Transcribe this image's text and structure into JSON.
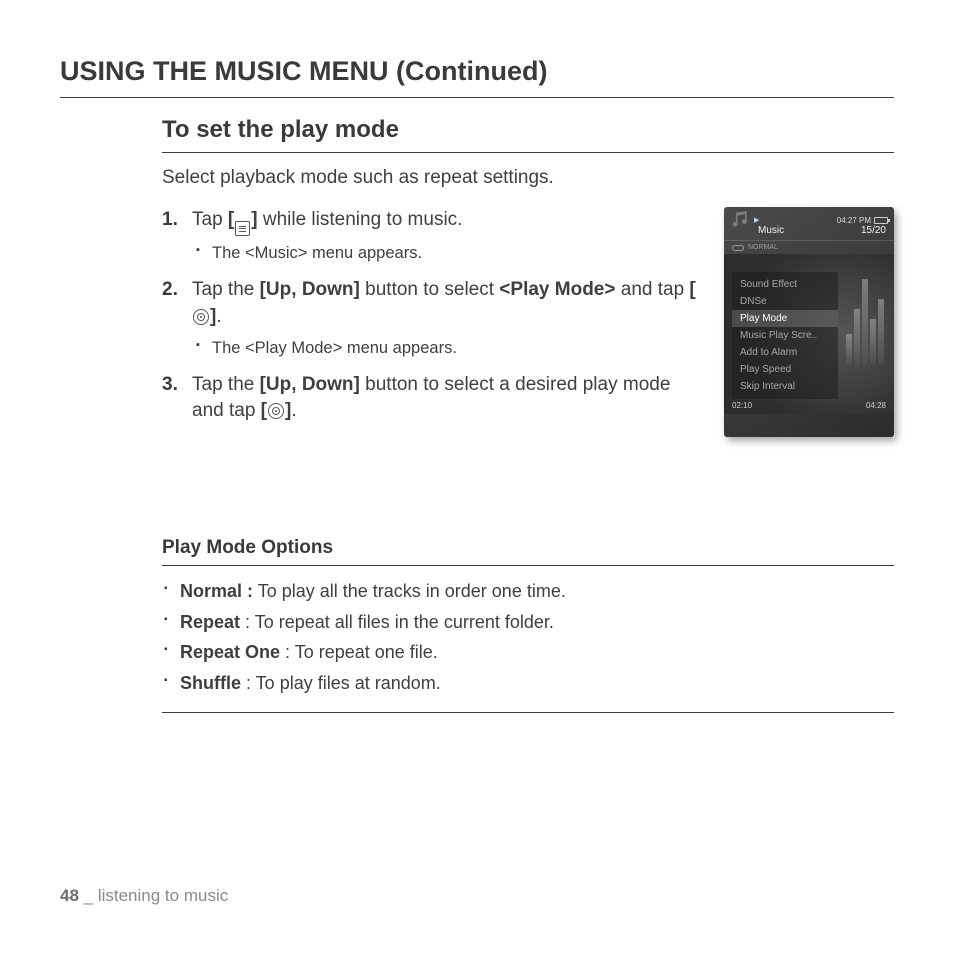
{
  "header": {
    "title": "USING THE MUSIC MENU (Continued)"
  },
  "section": {
    "title": "To set the play mode",
    "intro": "Select playback mode such as repeat settings."
  },
  "steps": [
    {
      "pre": "Tap ",
      "btn_open": "[",
      "btn_close": "]",
      "icon": "menu-icon",
      "post": " while listening to music.",
      "sub": "The <Music> menu appears."
    },
    {
      "pre": "Tap the ",
      "bold1": "[Up, Down]",
      "mid1": " button to select ",
      "bold2": "<Play Mode>",
      "mid2": " and tap ",
      "btn_open": "[",
      "btn_close": "]",
      "icon": "target-icon",
      "post": ".",
      "sub": "The <Play Mode> menu appears."
    },
    {
      "pre": "Tap the ",
      "bold1": "[Up, Down]",
      "mid1": " button to select a desired play mode and tap ",
      "btn_open": "[",
      "btn_close": "]",
      "icon": "target-icon",
      "post": "."
    }
  ],
  "device": {
    "clock": "04:27 PM",
    "title": "Music",
    "track_count": "15/20",
    "mode_label": "NORMAL",
    "menu": [
      "Sound Effect",
      "DNSe",
      "Play Mode",
      "Music Play Scre..",
      "Add to Alarm",
      "Play Speed",
      "Skip Interval"
    ],
    "menu_selected_index": 2,
    "time_left": "02:10",
    "time_right": "04:28"
  },
  "options": {
    "title": "Play Mode Options",
    "items": [
      {
        "name": "Normal :",
        "desc": " To play all the tracks in order one time."
      },
      {
        "name": "Repeat",
        "desc": " : To repeat all files in the current folder."
      },
      {
        "name": "Repeat One",
        "desc": " : To repeat one file."
      },
      {
        "name": "Shuffle",
        "desc": " : To play files at random."
      }
    ]
  },
  "footer": {
    "page": "48",
    "sep": " _ ",
    "chapter": "listening to music"
  }
}
